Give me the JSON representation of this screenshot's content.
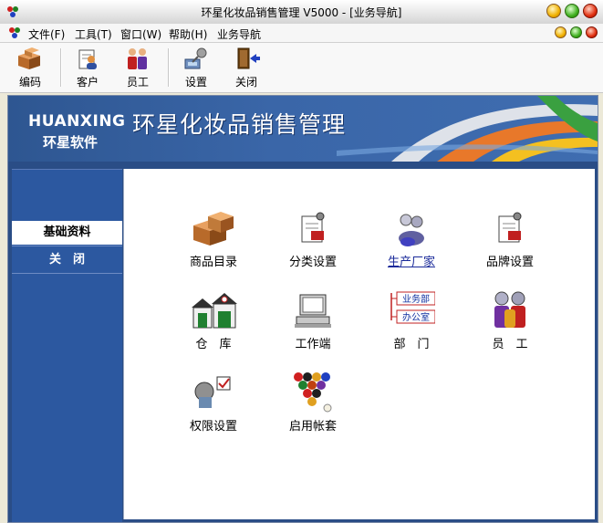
{
  "window": {
    "title": "环星化妆品销售管理 V5000 - [业务导航]"
  },
  "menu": [
    "文件(F)",
    "工具(T)",
    "窗口(W)",
    "帮助(H)",
    "业务导航"
  ],
  "toolbar": {
    "buttons": [
      {
        "label": "编码",
        "icon": "boxes-icon"
      },
      {
        "label": "客户",
        "icon": "customer-icon"
      },
      {
        "label": "员工",
        "icon": "staff-icon"
      },
      {
        "label": "设置",
        "icon": "settings-icon"
      },
      {
        "label": "关闭",
        "icon": "exit-door-icon"
      }
    ]
  },
  "banner": {
    "brand_en": "HUANXING",
    "brand_cn": "环星软件",
    "title": "环星化妆品销售管理"
  },
  "sidebar": {
    "items": [
      {
        "label": "基础资料",
        "active": true
      },
      {
        "label": "关　闭",
        "active": false
      }
    ]
  },
  "modules": [
    {
      "label": "商品目录",
      "icon": "product-boxes-icon"
    },
    {
      "label": "分类设置",
      "icon": "category-settings-icon"
    },
    {
      "label": "生产厂家",
      "icon": "manufacturer-icon",
      "link": true
    },
    {
      "label": "品牌设置",
      "icon": "brand-settings-icon"
    },
    {
      "label": "仓　库",
      "icon": "warehouse-icon"
    },
    {
      "label": "工作端",
      "icon": "workstation-icon"
    },
    {
      "label": "部　门",
      "icon": "department-icon",
      "sub": [
        "业务部",
        "办公室"
      ]
    },
    {
      "label": "员　工",
      "icon": "employees-icon"
    },
    {
      "label": "权限设置",
      "icon": "permission-icon"
    },
    {
      "label": "启用帐套",
      "icon": "billiard-rack-icon"
    }
  ],
  "colors": {
    "frame_blue": "#2a4d86",
    "sidebar_blue": "#2c58a0",
    "banner_blue": "#3a66a8"
  }
}
